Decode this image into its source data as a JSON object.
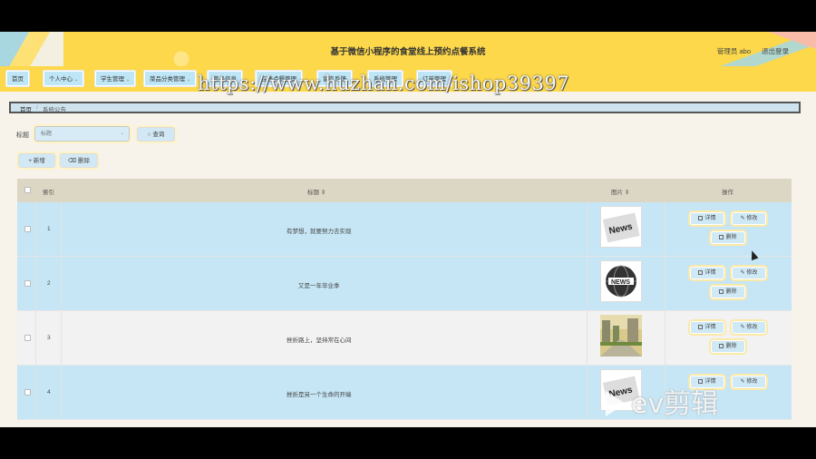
{
  "header": {
    "title": "基于微信小程序的食堂线上预约点餐系统",
    "admin": "管理员 abo",
    "logout": "退出登录"
  },
  "nav": [
    {
      "label": "首页",
      "chevron": false
    },
    {
      "label": "个人中心",
      "chevron": true
    },
    {
      "label": "学生管理",
      "chevron": true
    },
    {
      "label": "菜品分类管理",
      "chevron": true
    },
    {
      "label": "菜品信息",
      "chevron": false
    },
    {
      "label": "在线点餐管理",
      "chevron": false
    },
    {
      "label": "留言反馈",
      "chevron": false
    },
    {
      "label": "系统管理",
      "chevron": false
    },
    {
      "label": "订单管理",
      "chevron": false
    }
  ],
  "breadcrumb": {
    "home": "首页",
    "sep": "/",
    "current": "系统公告"
  },
  "search": {
    "label": "标题",
    "placeholder": "标题",
    "button": "查询"
  },
  "toolbar": {
    "add": "新增",
    "delete": "删除"
  },
  "table": {
    "headers": {
      "index": "索引",
      "title": "标题",
      "image": "图片",
      "action": "操作"
    },
    "rows": [
      {
        "index": "1",
        "title": "有梦想，就要努力去实现",
        "image": "news-paper"
      },
      {
        "index": "2",
        "title": "又是一年毕业季",
        "image": "news-globe"
      },
      {
        "index": "3",
        "title": "挫折路上，坚持常在心间",
        "image": "city-street"
      },
      {
        "index": "4",
        "title": "挫折是另一个生命的开端",
        "image": "news-paper"
      }
    ],
    "actions": {
      "detail": "详情",
      "edit": "修改",
      "delete": "删除"
    }
  },
  "watermark": "https://www.huzhan.com/ishop39397",
  "overlay_logo": "ev剪辑",
  "colors": {
    "header": "#fdd84a",
    "nav_button": "#bfe6f6",
    "row_highlight": "#c6e6f6",
    "page_bg": "#f7f3ea"
  }
}
